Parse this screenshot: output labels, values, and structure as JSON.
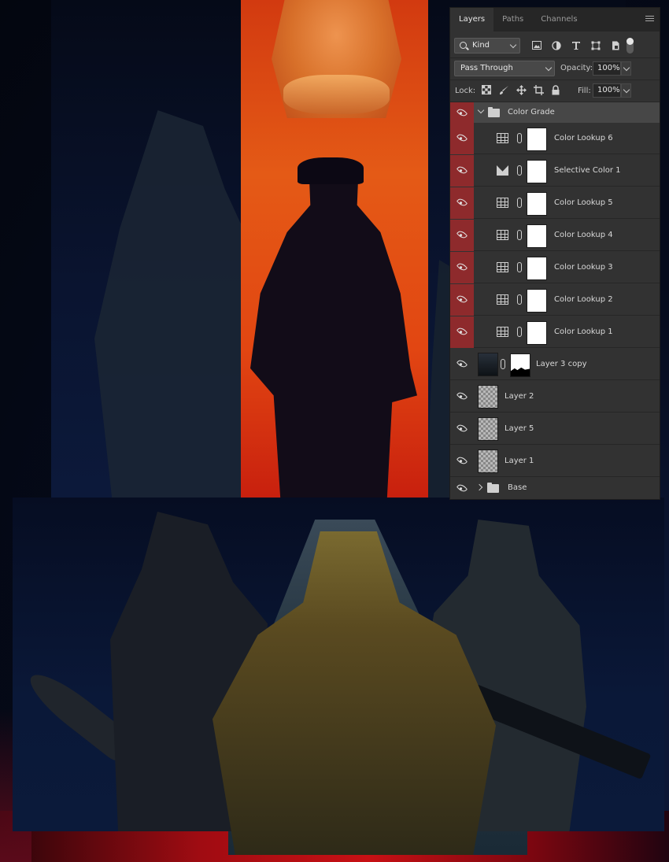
{
  "panel": {
    "tabs": [
      {
        "label": "Layers",
        "active": true
      },
      {
        "label": "Paths",
        "active": false
      },
      {
        "label": "Channels",
        "active": false
      }
    ],
    "filter": {
      "kind_label": "Kind",
      "icons": [
        "image-filter-icon",
        "adjustment-filter-icon",
        "type-filter-icon",
        "shape-filter-icon",
        "smart-object-filter-icon"
      ]
    },
    "blend_mode": "Pass Through",
    "opacity_label": "Opacity:",
    "opacity": "100%",
    "lock_label": "Lock:",
    "fill_label": "Fill:",
    "fill": "100%",
    "accent_color": "#8e2a2c"
  },
  "layers": [
    {
      "name": "Color Grade",
      "type": "group",
      "expanded": true
    },
    {
      "name": "Color Lookup 6",
      "type": "color-lookup"
    },
    {
      "name": "Selective Color 1",
      "type": "selective-color"
    },
    {
      "name": "Color Lookup 5",
      "type": "color-lookup"
    },
    {
      "name": "Color Lookup 4",
      "type": "color-lookup"
    },
    {
      "name": "Color Lookup 3",
      "type": "color-lookup"
    },
    {
      "name": "Color Lookup 2",
      "type": "color-lookup"
    },
    {
      "name": "Color Lookup 1",
      "type": "color-lookup"
    },
    {
      "name": "Layer 3 copy",
      "type": "masked-layer"
    },
    {
      "name": "Layer 2",
      "type": "pixel"
    },
    {
      "name": "Layer 5",
      "type": "pixel"
    },
    {
      "name": "Layer 1",
      "type": "pixel"
    },
    {
      "name": "Base",
      "type": "group",
      "expanded": false
    }
  ]
}
